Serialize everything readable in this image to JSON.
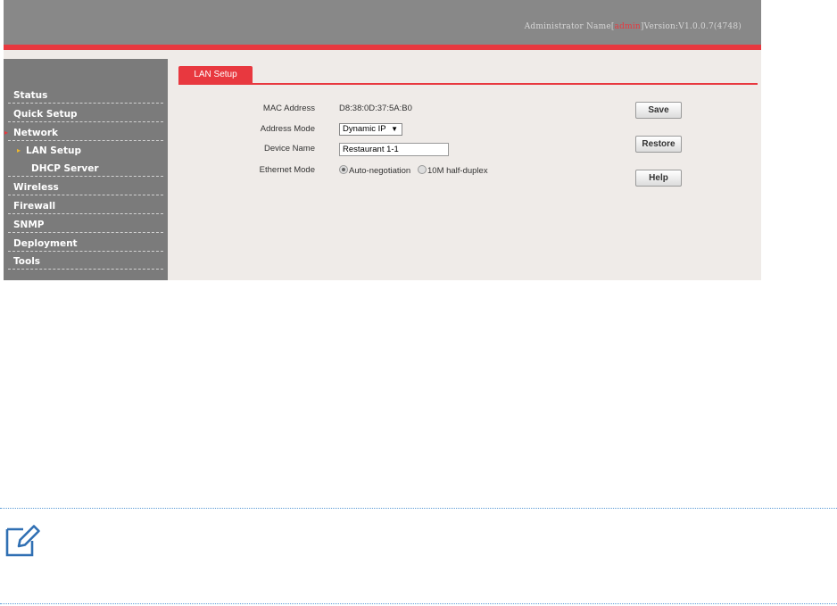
{
  "header": {
    "admin_prefix": "Administrator Name[",
    "admin_user": "admin",
    "version_text": "]Version:V1.0.0.7(4748)"
  },
  "sidebar": {
    "items": [
      {
        "label": "Status"
      },
      {
        "label": "Quick Setup"
      },
      {
        "label": "Network",
        "arrow": "▸"
      },
      {
        "label": "LAN Setup",
        "arrow": "▸"
      },
      {
        "label": "DHCP Server"
      },
      {
        "label": "Wireless"
      },
      {
        "label": "Firewall"
      },
      {
        "label": "SNMP"
      },
      {
        "label": "Deployment"
      },
      {
        "label": "Tools"
      }
    ]
  },
  "main": {
    "tab_label": "LAN Setup",
    "fields": {
      "mac_label": "MAC Address",
      "mac_value": "D8:38:0D:37:5A:B0",
      "mode_label": "Address Mode",
      "mode_value": "Dynamic IP",
      "device_label": "Device Name",
      "device_value": "Restaurant 1-1",
      "eth_label": "Ethernet Mode",
      "eth_option1": "Auto-negotiation",
      "eth_option2": "10M half-duplex"
    },
    "buttons": {
      "save": "Save",
      "restore": "Restore",
      "help": "Help"
    }
  },
  "colors": {
    "accent": "#e8383f",
    "sidebar": "#7b7b7b",
    "header": "#888888",
    "note_icon": "#2f6fb3"
  },
  "icons": {
    "note": "pencil-note-icon",
    "select_caret": "caret-down-icon"
  }
}
